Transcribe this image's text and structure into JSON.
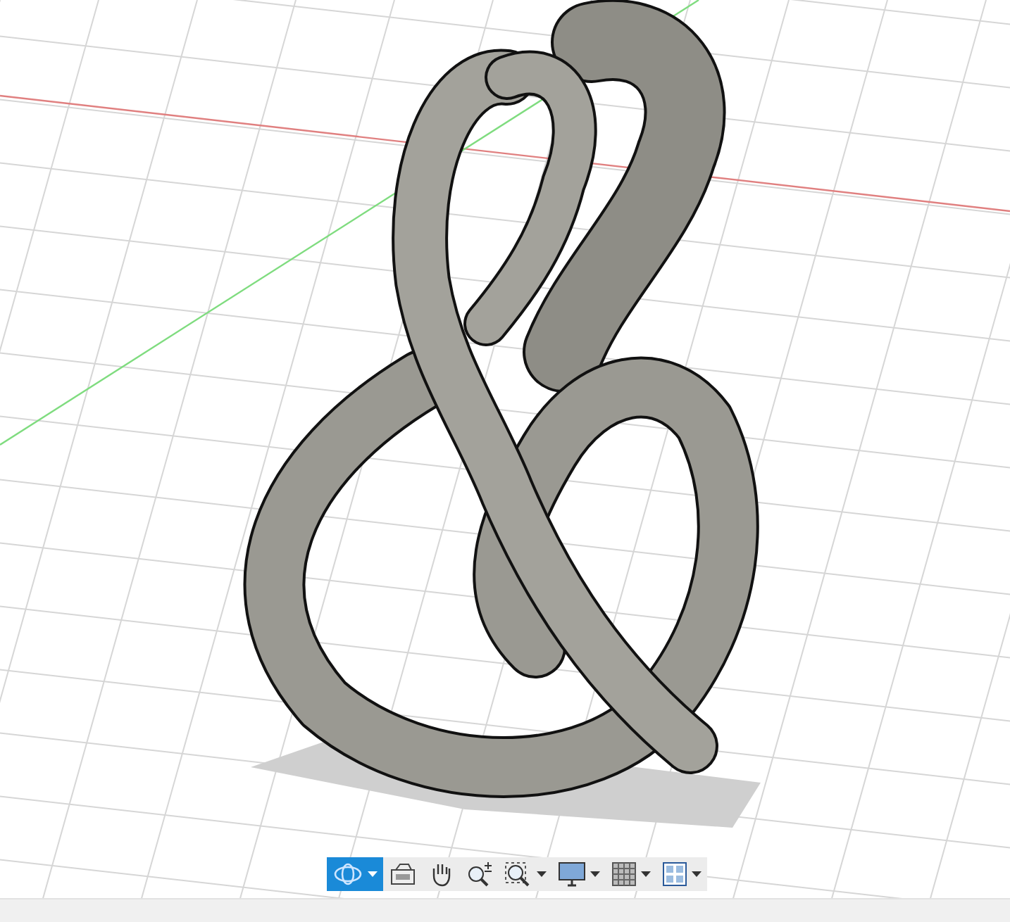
{
  "navigation_toolbar": {
    "tools": [
      {
        "kind": "orbit",
        "selected": true,
        "dropdown": true
      },
      {
        "kind": "look-at",
        "selected": false,
        "dropdown": false
      },
      {
        "kind": "pan",
        "selected": false,
        "dropdown": false
      },
      {
        "kind": "zoom",
        "selected": false,
        "dropdown": false
      },
      {
        "kind": "fit",
        "selected": false,
        "dropdown": true
      },
      {
        "kind": "display",
        "selected": false,
        "dropdown": true
      },
      {
        "kind": "grid",
        "selected": false,
        "dropdown": true
      },
      {
        "kind": "viewports",
        "selected": false,
        "dropdown": true
      }
    ]
  }
}
